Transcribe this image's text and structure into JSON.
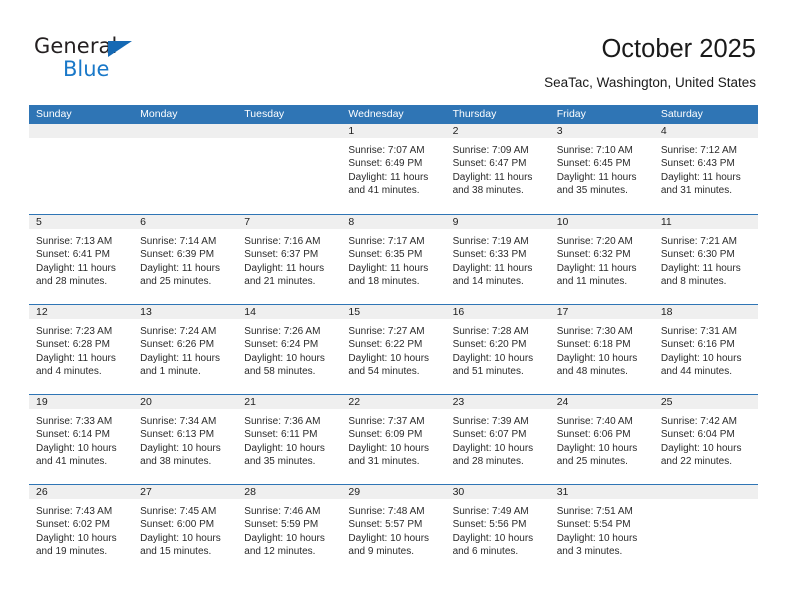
{
  "brand": {
    "name_part1": "General",
    "name_part2": "Blue"
  },
  "header": {
    "title": "October 2025",
    "subtitle": "SeaTac, Washington, United States"
  },
  "calendar": {
    "weekday_headers": [
      "Sunday",
      "Monday",
      "Tuesday",
      "Wednesday",
      "Thursday",
      "Friday",
      "Saturday"
    ],
    "colors": {
      "header_blue": "#2f75b5",
      "daynum_band": "#efefef",
      "logo_blue": "#1978c8"
    },
    "weeks": [
      [
        {
          "day": "",
          "sunrise": "",
          "sunset": "",
          "daylight_1": "",
          "daylight_2": ""
        },
        {
          "day": "",
          "sunrise": "",
          "sunset": "",
          "daylight_1": "",
          "daylight_2": ""
        },
        {
          "day": "",
          "sunrise": "",
          "sunset": "",
          "daylight_1": "",
          "daylight_2": ""
        },
        {
          "day": "1",
          "sunrise": "Sunrise: 7:07 AM",
          "sunset": "Sunset: 6:49 PM",
          "daylight_1": "Daylight: 11 hours",
          "daylight_2": "and 41 minutes."
        },
        {
          "day": "2",
          "sunrise": "Sunrise: 7:09 AM",
          "sunset": "Sunset: 6:47 PM",
          "daylight_1": "Daylight: 11 hours",
          "daylight_2": "and 38 minutes."
        },
        {
          "day": "3",
          "sunrise": "Sunrise: 7:10 AM",
          "sunset": "Sunset: 6:45 PM",
          "daylight_1": "Daylight: 11 hours",
          "daylight_2": "and 35 minutes."
        },
        {
          "day": "4",
          "sunrise": "Sunrise: 7:12 AM",
          "sunset": "Sunset: 6:43 PM",
          "daylight_1": "Daylight: 11 hours",
          "daylight_2": "and 31 minutes."
        }
      ],
      [
        {
          "day": "5",
          "sunrise": "Sunrise: 7:13 AM",
          "sunset": "Sunset: 6:41 PM",
          "daylight_1": "Daylight: 11 hours",
          "daylight_2": "and 28 minutes."
        },
        {
          "day": "6",
          "sunrise": "Sunrise: 7:14 AM",
          "sunset": "Sunset: 6:39 PM",
          "daylight_1": "Daylight: 11 hours",
          "daylight_2": "and 25 minutes."
        },
        {
          "day": "7",
          "sunrise": "Sunrise: 7:16 AM",
          "sunset": "Sunset: 6:37 PM",
          "daylight_1": "Daylight: 11 hours",
          "daylight_2": "and 21 minutes."
        },
        {
          "day": "8",
          "sunrise": "Sunrise: 7:17 AM",
          "sunset": "Sunset: 6:35 PM",
          "daylight_1": "Daylight: 11 hours",
          "daylight_2": "and 18 minutes."
        },
        {
          "day": "9",
          "sunrise": "Sunrise: 7:19 AM",
          "sunset": "Sunset: 6:33 PM",
          "daylight_1": "Daylight: 11 hours",
          "daylight_2": "and 14 minutes."
        },
        {
          "day": "10",
          "sunrise": "Sunrise: 7:20 AM",
          "sunset": "Sunset: 6:32 PM",
          "daylight_1": "Daylight: 11 hours",
          "daylight_2": "and 11 minutes."
        },
        {
          "day": "11",
          "sunrise": "Sunrise: 7:21 AM",
          "sunset": "Sunset: 6:30 PM",
          "daylight_1": "Daylight: 11 hours",
          "daylight_2": "and 8 minutes."
        }
      ],
      [
        {
          "day": "12",
          "sunrise": "Sunrise: 7:23 AM",
          "sunset": "Sunset: 6:28 PM",
          "daylight_1": "Daylight: 11 hours",
          "daylight_2": "and 4 minutes."
        },
        {
          "day": "13",
          "sunrise": "Sunrise: 7:24 AM",
          "sunset": "Sunset: 6:26 PM",
          "daylight_1": "Daylight: 11 hours",
          "daylight_2": "and 1 minute."
        },
        {
          "day": "14",
          "sunrise": "Sunrise: 7:26 AM",
          "sunset": "Sunset: 6:24 PM",
          "daylight_1": "Daylight: 10 hours",
          "daylight_2": "and 58 minutes."
        },
        {
          "day": "15",
          "sunrise": "Sunrise: 7:27 AM",
          "sunset": "Sunset: 6:22 PM",
          "daylight_1": "Daylight: 10 hours",
          "daylight_2": "and 54 minutes."
        },
        {
          "day": "16",
          "sunrise": "Sunrise: 7:28 AM",
          "sunset": "Sunset: 6:20 PM",
          "daylight_1": "Daylight: 10 hours",
          "daylight_2": "and 51 minutes."
        },
        {
          "day": "17",
          "sunrise": "Sunrise: 7:30 AM",
          "sunset": "Sunset: 6:18 PM",
          "daylight_1": "Daylight: 10 hours",
          "daylight_2": "and 48 minutes."
        },
        {
          "day": "18",
          "sunrise": "Sunrise: 7:31 AM",
          "sunset": "Sunset: 6:16 PM",
          "daylight_1": "Daylight: 10 hours",
          "daylight_2": "and 44 minutes."
        }
      ],
      [
        {
          "day": "19",
          "sunrise": "Sunrise: 7:33 AM",
          "sunset": "Sunset: 6:14 PM",
          "daylight_1": "Daylight: 10 hours",
          "daylight_2": "and 41 minutes."
        },
        {
          "day": "20",
          "sunrise": "Sunrise: 7:34 AM",
          "sunset": "Sunset: 6:13 PM",
          "daylight_1": "Daylight: 10 hours",
          "daylight_2": "and 38 minutes."
        },
        {
          "day": "21",
          "sunrise": "Sunrise: 7:36 AM",
          "sunset": "Sunset: 6:11 PM",
          "daylight_1": "Daylight: 10 hours",
          "daylight_2": "and 35 minutes."
        },
        {
          "day": "22",
          "sunrise": "Sunrise: 7:37 AM",
          "sunset": "Sunset: 6:09 PM",
          "daylight_1": "Daylight: 10 hours",
          "daylight_2": "and 31 minutes."
        },
        {
          "day": "23",
          "sunrise": "Sunrise: 7:39 AM",
          "sunset": "Sunset: 6:07 PM",
          "daylight_1": "Daylight: 10 hours",
          "daylight_2": "and 28 minutes."
        },
        {
          "day": "24",
          "sunrise": "Sunrise: 7:40 AM",
          "sunset": "Sunset: 6:06 PM",
          "daylight_1": "Daylight: 10 hours",
          "daylight_2": "and 25 minutes."
        },
        {
          "day": "25",
          "sunrise": "Sunrise: 7:42 AM",
          "sunset": "Sunset: 6:04 PM",
          "daylight_1": "Daylight: 10 hours",
          "daylight_2": "and 22 minutes."
        }
      ],
      [
        {
          "day": "26",
          "sunrise": "Sunrise: 7:43 AM",
          "sunset": "Sunset: 6:02 PM",
          "daylight_1": "Daylight: 10 hours",
          "daylight_2": "and 19 minutes."
        },
        {
          "day": "27",
          "sunrise": "Sunrise: 7:45 AM",
          "sunset": "Sunset: 6:00 PM",
          "daylight_1": "Daylight: 10 hours",
          "daylight_2": "and 15 minutes."
        },
        {
          "day": "28",
          "sunrise": "Sunrise: 7:46 AM",
          "sunset": "Sunset: 5:59 PM",
          "daylight_1": "Daylight: 10 hours",
          "daylight_2": "and 12 minutes."
        },
        {
          "day": "29",
          "sunrise": "Sunrise: 7:48 AM",
          "sunset": "Sunset: 5:57 PM",
          "daylight_1": "Daylight: 10 hours",
          "daylight_2": "and 9 minutes."
        },
        {
          "day": "30",
          "sunrise": "Sunrise: 7:49 AM",
          "sunset": "Sunset: 5:56 PM",
          "daylight_1": "Daylight: 10 hours",
          "daylight_2": "and 6 minutes."
        },
        {
          "day": "31",
          "sunrise": "Sunrise: 7:51 AM",
          "sunset": "Sunset: 5:54 PM",
          "daylight_1": "Daylight: 10 hours",
          "daylight_2": "and 3 minutes."
        },
        {
          "day": "",
          "sunrise": "",
          "sunset": "",
          "daylight_1": "",
          "daylight_2": ""
        }
      ]
    ]
  }
}
